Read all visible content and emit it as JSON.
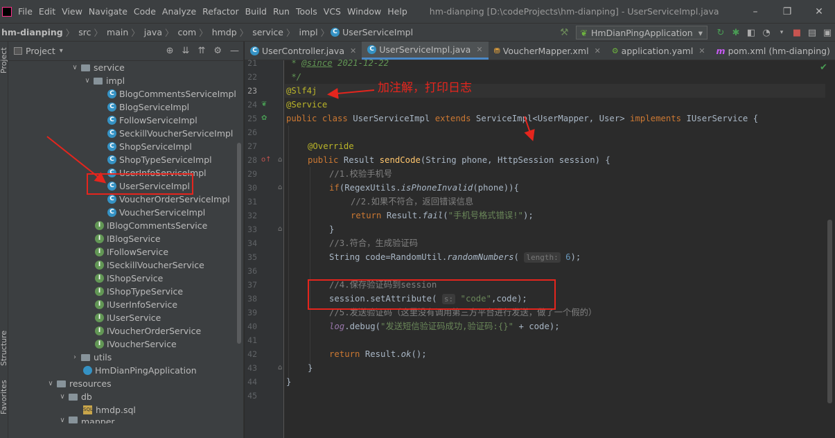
{
  "menubar": {
    "items": [
      "File",
      "Edit",
      "View",
      "Navigate",
      "Code",
      "Analyze",
      "Refactor",
      "Build",
      "Run",
      "Tools",
      "VCS",
      "Window",
      "Help"
    ],
    "window_title": "hm-dianping [D:\\codeProjects\\hm-dianping] - UserServiceImpl.java",
    "controls": [
      "–",
      "❐",
      "✕"
    ]
  },
  "navbar": {
    "crumbs": [
      "hm-dianping",
      "src",
      "main",
      "java",
      "com",
      "hmdp",
      "service",
      "impl",
      "UserServiceImpl"
    ],
    "run_config": "HmDianPingApplication"
  },
  "side_strip": {
    "top_label": "Project",
    "structure_label": "Structure",
    "favorites_label": "Favorites"
  },
  "project_panel": {
    "title": "Project",
    "tree": [
      {
        "label": "service",
        "type": "folder",
        "expanded": true
      },
      {
        "label": "impl",
        "type": "folder",
        "expanded": true
      },
      {
        "label": "BlogCommentsServiceImpl",
        "type": "class"
      },
      {
        "label": "BlogServiceImpl",
        "type": "class"
      },
      {
        "label": "FollowServiceImpl",
        "type": "class"
      },
      {
        "label": "SeckillVoucherServiceImpl",
        "type": "class"
      },
      {
        "label": "ShopServiceImpl",
        "type": "class"
      },
      {
        "label": "ShopTypeServiceImpl",
        "type": "class"
      },
      {
        "label": "UserInfoServiceImpl",
        "type": "class"
      },
      {
        "label": "UserServiceImpl",
        "type": "class"
      },
      {
        "label": "VoucherOrderServiceImpl",
        "type": "class"
      },
      {
        "label": "VoucherServiceImpl",
        "type": "class"
      },
      {
        "label": "IBlogCommentsService",
        "type": "interface"
      },
      {
        "label": "IBlogService",
        "type": "interface"
      },
      {
        "label": "IFollowService",
        "type": "interface"
      },
      {
        "label": "ISeckillVoucherService",
        "type": "interface"
      },
      {
        "label": "IShopService",
        "type": "interface"
      },
      {
        "label": "IShopTypeService",
        "type": "interface"
      },
      {
        "label": "IUserInfoService",
        "type": "interface"
      },
      {
        "label": "IUserService",
        "type": "interface"
      },
      {
        "label": "IVoucherOrderService",
        "type": "interface"
      },
      {
        "label": "IVoucherService",
        "type": "interface"
      },
      {
        "label": "utils",
        "type": "folder",
        "expanded": false
      },
      {
        "label": "HmDianPingApplication",
        "type": "spring"
      },
      {
        "label": "resources",
        "type": "folder",
        "expanded": true
      },
      {
        "label": "db",
        "type": "folder",
        "expanded": true
      },
      {
        "label": "hmdp.sql",
        "type": "sql"
      },
      {
        "label": "mapper",
        "type": "folder",
        "expanded": true
      }
    ]
  },
  "editor": {
    "tabs": [
      {
        "label": "UserController.java",
        "icon": "class-icon",
        "active": false
      },
      {
        "label": "UserServiceImpl.java",
        "icon": "class-icon",
        "active": true
      },
      {
        "label": "VoucherMapper.xml",
        "icon": "xml-icon",
        "active": false
      },
      {
        "label": "application.yaml",
        "icon": "yaml-icon",
        "active": false
      },
      {
        "label": "pom.xml (hm-dianping)",
        "icon": "maven-icon",
        "active": false
      }
    ],
    "line_numbers": [
      "21",
      "22",
      "23",
      "24",
      "25",
      "26",
      "27",
      "28",
      "29",
      "30",
      "31",
      "32",
      "33",
      "34",
      "35",
      "36",
      "37",
      "38",
      "39",
      "40",
      "41",
      "42",
      "43",
      "44",
      "45"
    ],
    "code": {
      "l21_tag": "@since",
      "l21_date": " 2021-12-22",
      "l23_ann": "@Slf4j",
      "l24_ann": "@Service",
      "l25_kw1": "public class",
      "l25_name": " UserServiceImpl ",
      "l25_kw2": "extends",
      "l25_rest": " ServiceImpl<UserMapper, User> ",
      "l25_kw3": "implements",
      "l25_end": " IUserService {",
      "l27_ann": "@Override",
      "l28_kw": "public",
      "l28_type": " Result ",
      "l28_fn": "sendCode",
      "l28_rest": "(String phone, HttpSession session) {",
      "l29": "//1.校验手机号",
      "l30_kw": "if",
      "l30_a": "(RegexUtils.",
      "l30_m": "isPhoneInvalid",
      "l30_b": "(phone)){",
      "l31": "//2.如果不符合，返回错误信息",
      "l32_kw": "return",
      "l32_a": " Result.",
      "l32_m": "fail",
      "l32_str": "\"手机号格式错误!\"",
      "l32_end": ");",
      "l33": "}",
      "l34": "//3.符合，生成验证码",
      "l35_a": "String code=RandomUtil.",
      "l35_m": "randomNumbers",
      "l35_hint": "length:",
      "l35_num": "6",
      "l35_end": ");",
      "l37": "//4.保存验证码到session",
      "l38_a": "session.setAttribute(",
      "l38_hint": "s:",
      "l38_str": "\"code\"",
      "l38_end": ",code);",
      "l39": "//5.发送验证码（这里没有调用第三方平台进行发送，做了一个假的）",
      "l40_log": "log",
      "l40_a": ".debug(",
      "l40_str": "\"发送短信验证码成功,验证码:{}\"",
      "l40_end": "+ code);",
      "l42_kw": "return",
      "l42_a": " Result.",
      "l42_m": "ok",
      "l42_end": "();",
      "l43": "}",
      "l44": "}"
    }
  },
  "annotation": {
    "text": "加注解，打印日志"
  },
  "colors": {
    "accent": "#4a88c7",
    "annotation_red": "#e5251d",
    "editor_bg": "#2b2b2b"
  }
}
